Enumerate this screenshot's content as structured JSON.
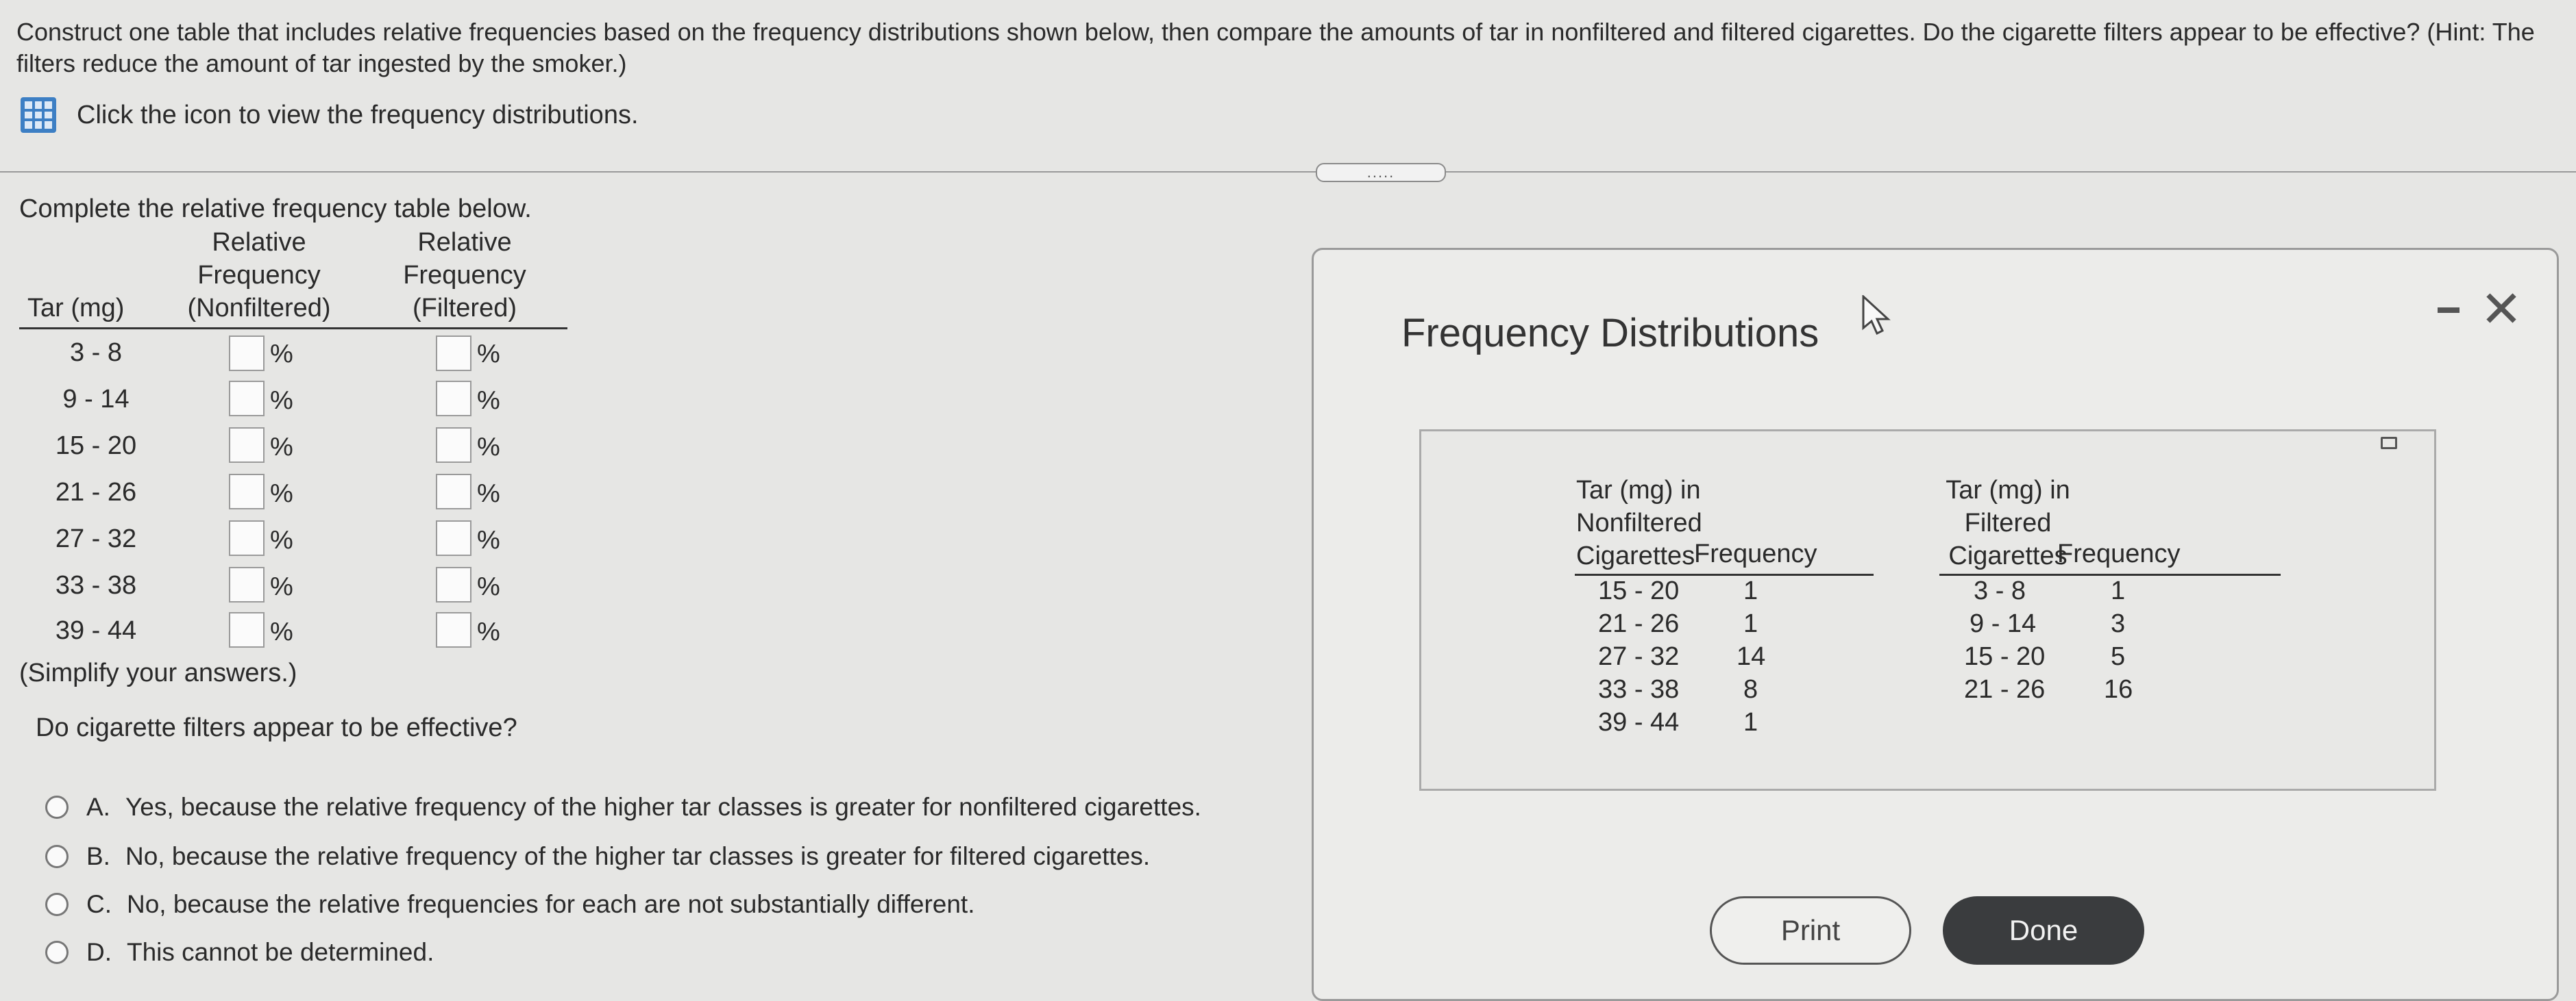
{
  "question": "Construct one table that includes relative frequencies based on the frequency distributions shown below, then compare the amounts of tar in nonfiltered and filtered cigarettes. Do the cigarette filters appear to be effective? (Hint: The filters reduce the amount of tar ingested by the smoker.)",
  "link": {
    "icon": "grid-icon",
    "label": "Click the icon to view the frequency distributions."
  },
  "drag_handle": ".....",
  "left": {
    "instruction": "Complete the relative frequency table below.",
    "headers": {
      "tar": "Tar (mg)",
      "nonfiltered": [
        "Relative",
        "Frequency",
        "(Nonfiltered)"
      ],
      "filtered": [
        "Relative",
        "Frequency",
        "(Filtered)"
      ]
    },
    "rows": [
      "3 - 8",
      "9 - 14",
      "15 - 20",
      "21 - 26",
      "27 - 32",
      "33 - 38",
      "39 - 44"
    ],
    "percent": "%",
    "simplify_note": "(Simplify your answers.)",
    "question2": "Do cigarette filters appear to be effective?",
    "options": [
      {
        "letter": "A.",
        "text": "Yes, because the relative frequency of the higher tar classes is greater for nonfiltered cigarettes."
      },
      {
        "letter": "B.",
        "text": "No, because the relative frequency of the higher tar classes is greater for filtered cigarettes."
      },
      {
        "letter": "C.",
        "text": "No, because the relative frequencies for each are not substantially different."
      },
      {
        "letter": "D.",
        "text": "This cannot be determined."
      }
    ]
  },
  "dialog": {
    "title": "Frequency Distributions",
    "nonfiltered": {
      "header": [
        "Tar (mg) in",
        "Nonfiltered",
        "Cigarettes"
      ],
      "freq_header": "Frequency",
      "rows": [
        {
          "tar": "15 - 20",
          "freq": "1"
        },
        {
          "tar": "21 - 26",
          "freq": "1"
        },
        {
          "tar": "27 - 32",
          "freq": "14"
        },
        {
          "tar": "33 - 38",
          "freq": "8"
        },
        {
          "tar": "39 - 44",
          "freq": "1"
        }
      ]
    },
    "filtered": {
      "header": [
        "Tar (mg) in",
        "Filtered",
        "Cigarettes"
      ],
      "freq_header": "Frequency",
      "rows": [
        {
          "tar": "3 - 8",
          "freq": "1"
        },
        {
          "tar": "9 - 14",
          "freq": "3"
        },
        {
          "tar": "15 - 20",
          "freq": "5"
        },
        {
          "tar": "21 - 26",
          "freq": "16"
        }
      ]
    },
    "print_label": "Print",
    "done_label": "Done",
    "minimize_icon": "minimize-icon",
    "close_icon": "close-icon"
  }
}
